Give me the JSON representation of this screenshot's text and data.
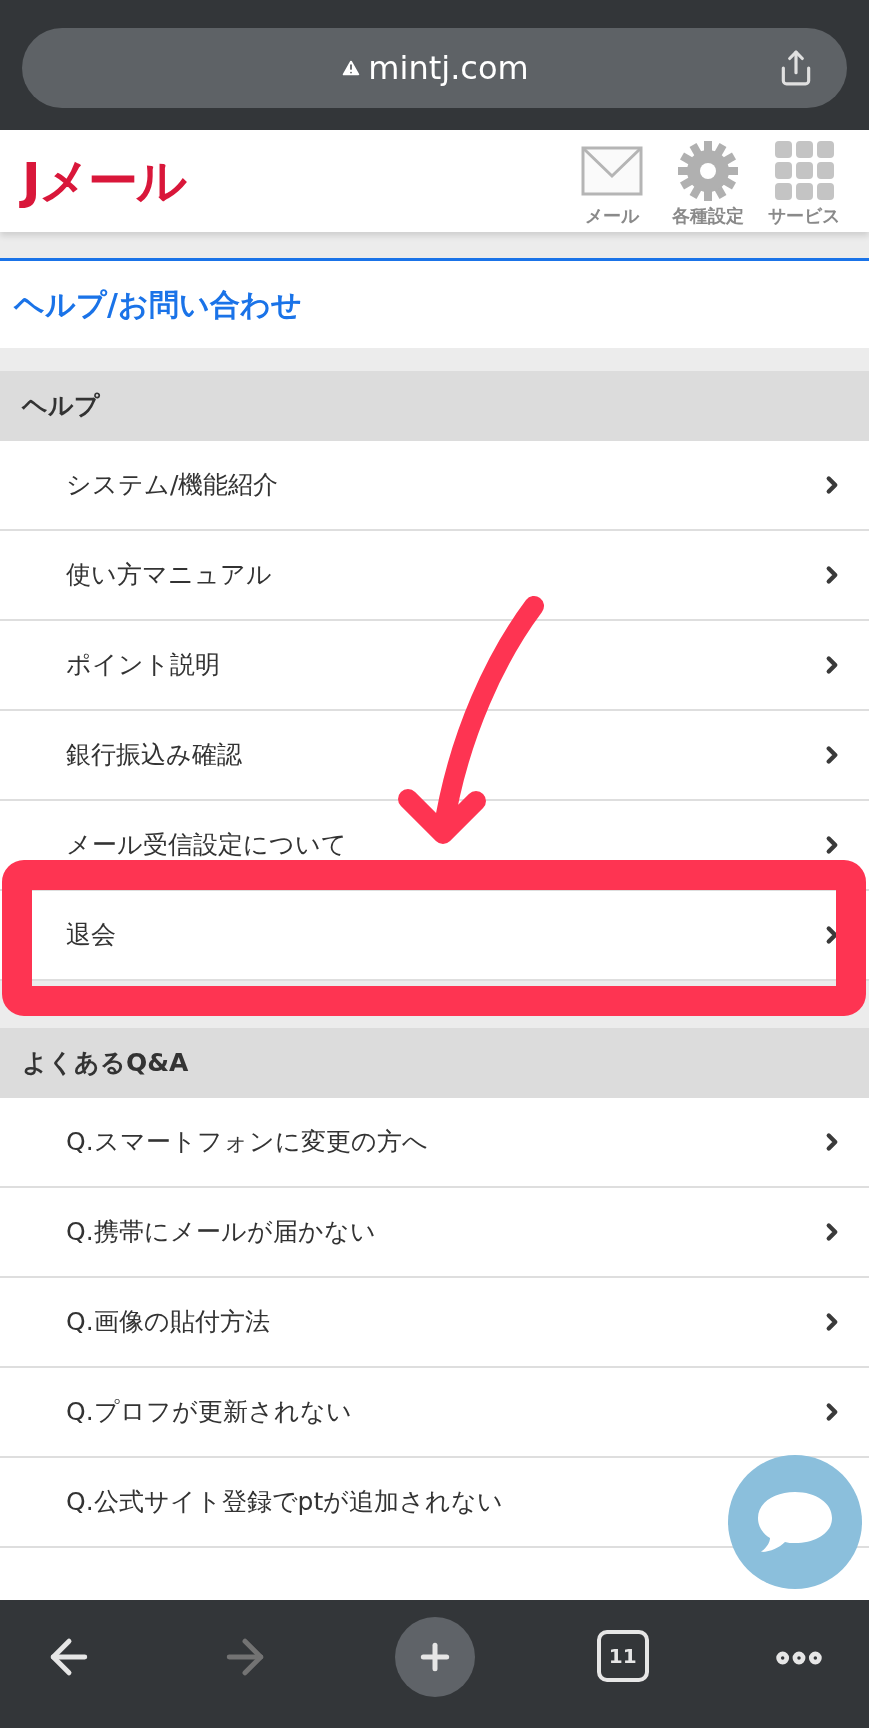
{
  "browser": {
    "address": "mintj.com",
    "tab_count": "11"
  },
  "header": {
    "logo": "Jメール",
    "nav": [
      {
        "label": "メール"
      },
      {
        "label": "各種設定"
      },
      {
        "label": "サービス"
      }
    ]
  },
  "page_title": "ヘルプ/お問い合わせ",
  "sections": [
    {
      "title": "ヘルプ",
      "items": [
        {
          "label": "システム/機能紹介",
          "highlighted": false
        },
        {
          "label": "使い方マニュアル",
          "highlighted": false
        },
        {
          "label": "ポイント説明",
          "highlighted": false
        },
        {
          "label": "銀行振込み確認",
          "highlighted": false
        },
        {
          "label": "メール受信設定について",
          "highlighted": false
        },
        {
          "label": "退会",
          "highlighted": true
        }
      ]
    },
    {
      "title": "よくあるQ&A",
      "items": [
        {
          "label": "Q.スマートフォンに変更の方へ",
          "highlighted": false
        },
        {
          "label": "Q.携帯にメールが届かない",
          "highlighted": false
        },
        {
          "label": "Q.画像の貼付方法",
          "highlighted": false
        },
        {
          "label": "Q.プロフが更新されない",
          "highlighted": false
        },
        {
          "label": "Q.公式サイト登録でptが追加されない",
          "highlighted": false
        }
      ]
    }
  ]
}
